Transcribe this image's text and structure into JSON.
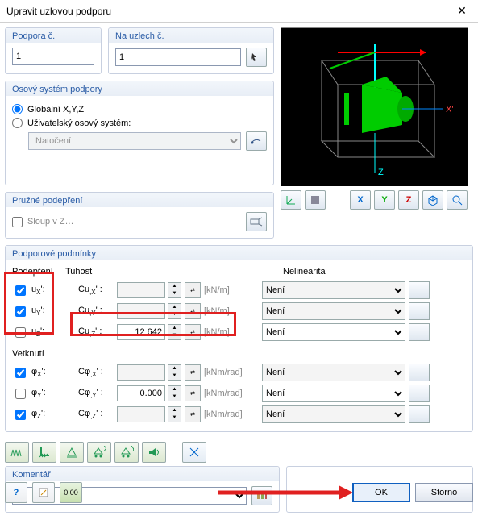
{
  "title": "Upravit uzlovou podporu",
  "support_no": {
    "label": "Podpora č.",
    "value": "1"
  },
  "on_nodes": {
    "label": "Na uzlech č.",
    "value": "1"
  },
  "axis_system": {
    "label": "Osový systém podpory",
    "opt_global": "Globální X,Y,Z",
    "opt_user": "Uživatelský osový systém:",
    "rotation": "Natočení"
  },
  "spring": {
    "label": "Pružné podepření",
    "column": "Sloup v Z…"
  },
  "cond": {
    "label": "Podporové podmínky",
    "sec_support": "Podepření",
    "sec_stiff": "Tuhost",
    "sec_nlin": "Nelinearita",
    "sec_fix": "Vetknutí",
    "rows_support": [
      {
        "lbl": "uX'",
        "stiff_lbl": "Cu,X'",
        "val": "",
        "unit": "[kN/m]",
        "checked": true,
        "nlin": "Není",
        "enabled": false
      },
      {
        "lbl": "uY'",
        "stiff_lbl": "Cu,Y'",
        "val": "",
        "unit": "[kN/m]",
        "checked": true,
        "nlin": "Není",
        "enabled": false
      },
      {
        "lbl": "uZ'",
        "stiff_lbl": "Cu,Z'",
        "val": "12 642",
        "unit": "[kN/m]",
        "checked": false,
        "nlin": "Není",
        "enabled": true
      }
    ],
    "rows_fix": [
      {
        "lbl": "φX'",
        "stiff_lbl": "Cφ,X'",
        "val": "",
        "unit": "[kNm/rad]",
        "checked": true,
        "nlin": "Není",
        "enabled": false
      },
      {
        "lbl": "φY'",
        "stiff_lbl": "Cφ,Y'",
        "val": "0.000",
        "unit": "[kNm/rad]",
        "checked": false,
        "nlin": "Není",
        "enabled": true
      },
      {
        "lbl": "φZ'",
        "stiff_lbl": "Cφ,Z'",
        "val": "",
        "unit": "[kNm/rad]",
        "checked": true,
        "nlin": "Není",
        "enabled": false
      }
    ]
  },
  "comment": {
    "label": "Komentář"
  },
  "footer": {
    "ok": "OK",
    "cancel": "Storno"
  }
}
